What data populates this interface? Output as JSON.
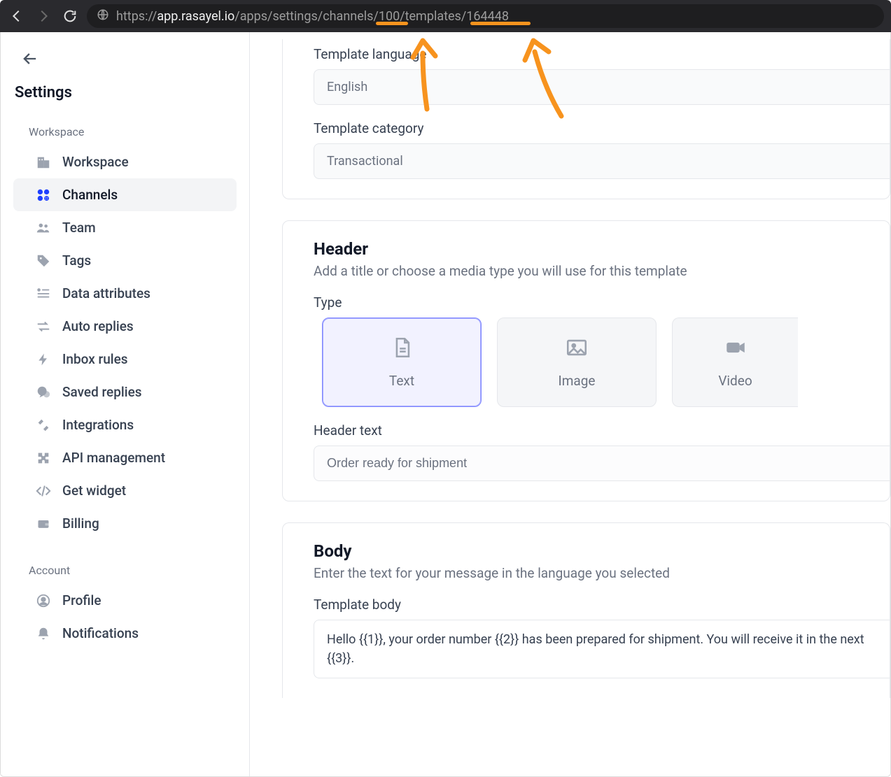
{
  "browser": {
    "url_prefix": "https://",
    "url_host": "app.rasayel.io",
    "url_path": "/apps/settings/channels/100/templates/164448"
  },
  "sidebar": {
    "title": "Settings",
    "sections": {
      "workspace": {
        "label": "Workspace",
        "items": [
          "Workspace",
          "Channels",
          "Team",
          "Tags",
          "Data attributes",
          "Auto replies",
          "Inbox rules",
          "Saved replies",
          "Integrations",
          "API management",
          "Get widget",
          "Billing"
        ]
      },
      "account": {
        "label": "Account",
        "items": [
          "Profile",
          "Notifications"
        ]
      }
    }
  },
  "template_top": {
    "language_label": "Template language",
    "language_value": "English",
    "category_label": "Template category",
    "category_value": "Transactional"
  },
  "header_card": {
    "title": "Header",
    "subtitle": "Add a title or choose a media type you will use for this template",
    "type_label": "Type",
    "types": {
      "text": "Text",
      "image": "Image",
      "video": "Video"
    },
    "header_text_label": "Header text",
    "header_text_value": "Order ready for shipment"
  },
  "body_card": {
    "title": "Body",
    "subtitle": "Enter the text for your message in the language you selected",
    "body_label": "Template body",
    "body_value": "Hello {{1}}, your order number {{2}} has been prepared for shipment. You will receive it in the next {{3}}."
  }
}
